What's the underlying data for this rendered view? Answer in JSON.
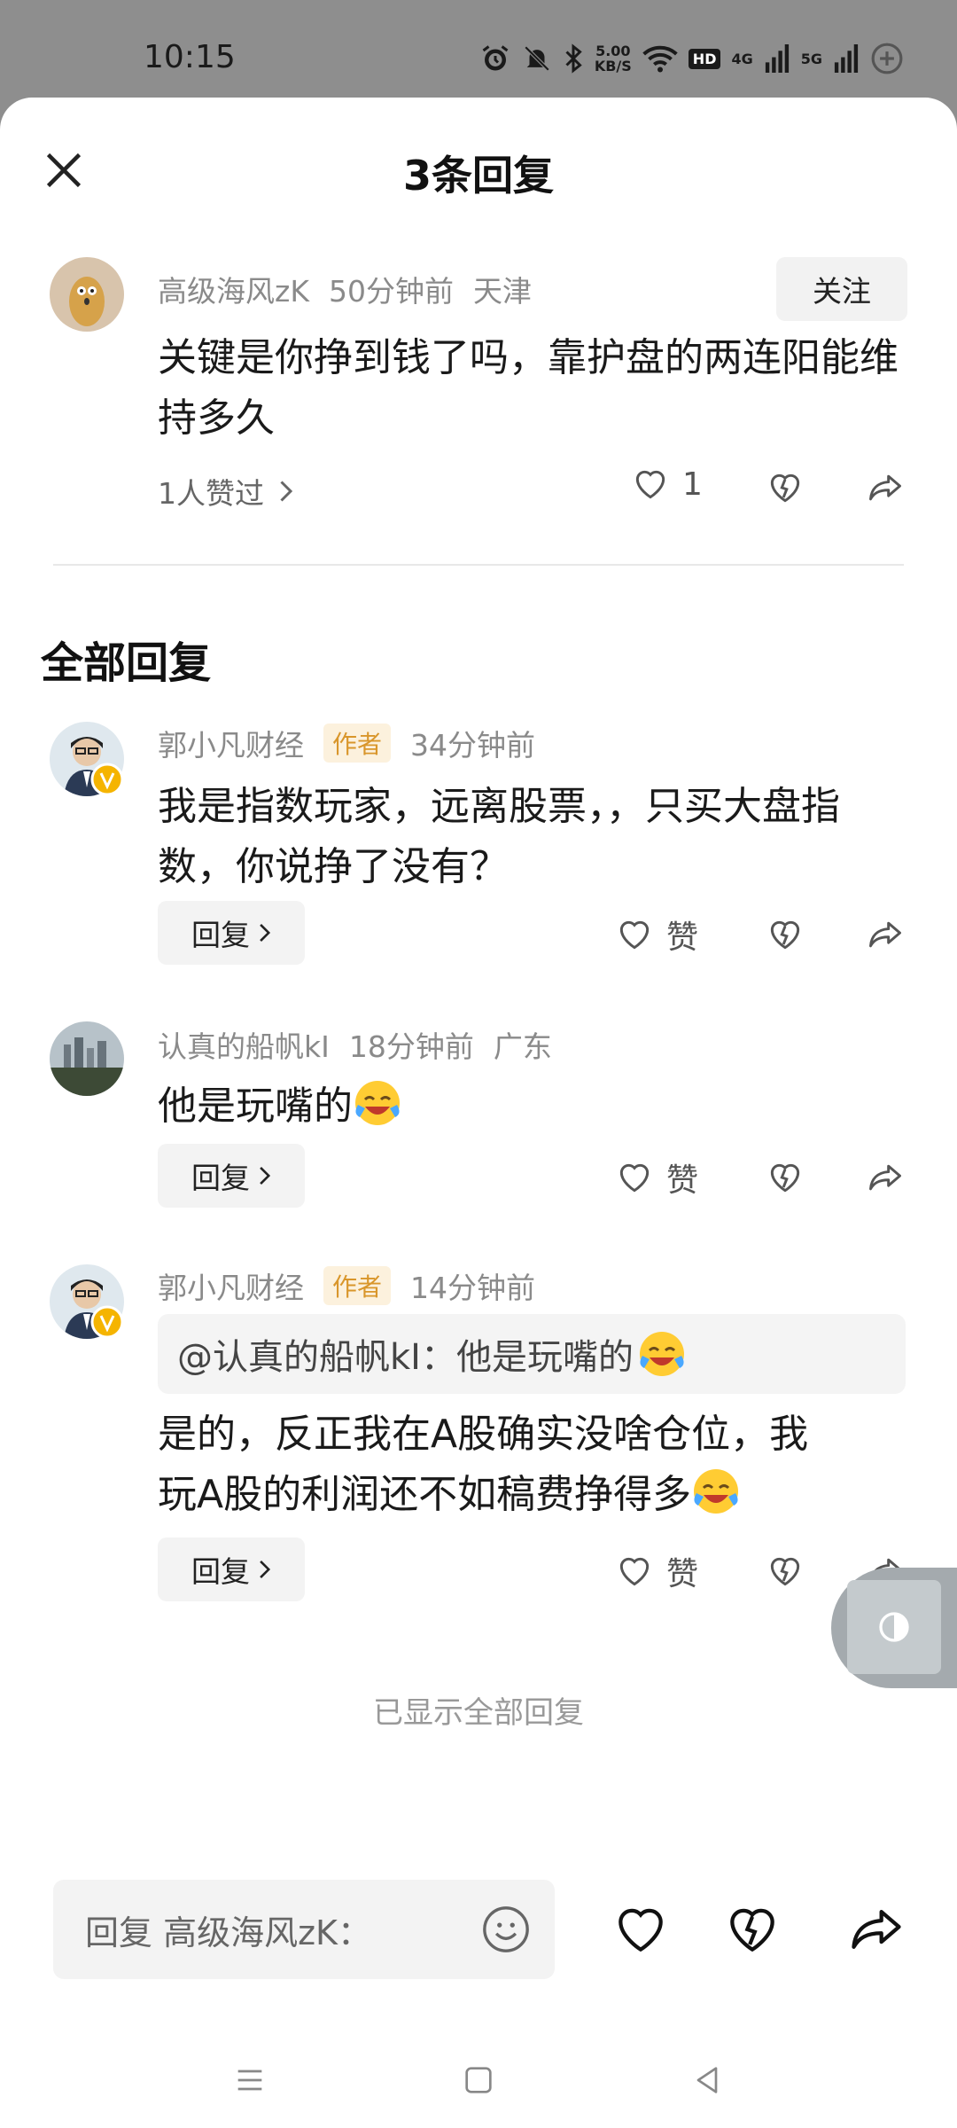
{
  "status_bar": {
    "time": "10:15",
    "net_speed_value": "5.00",
    "net_speed_unit": "KB/S",
    "hd_label": "HD",
    "net1": "4G",
    "net2": "5G"
  },
  "header": {
    "title": "3条回复"
  },
  "original_comment": {
    "user": "高级海风zK",
    "time": "50分钟前",
    "location": "天津",
    "follow_label": "关注",
    "text": "关键是你挣到钱了吗，靠护盘的两连阳能维持多久",
    "likes_link": "1人赞过",
    "like_count": "1"
  },
  "section_title": "全部回复",
  "replies": [
    {
      "user": "郭小凡财经",
      "badge": "作者",
      "time": "34分钟前",
      "text": "我是指数玩家，远离股票，，只买大盘指数，你说挣了没有？",
      "reply_label": "回复",
      "like_label": "赞"
    },
    {
      "user": "认真的船帆kI",
      "time": "18分钟前",
      "location": "广东",
      "text": "他是玩嘴的",
      "reply_label": "回复",
      "like_label": "赞"
    },
    {
      "user": "郭小凡财经",
      "badge": "作者",
      "time": "14分钟前",
      "quote": "@认真的船帆kI：他是玩嘴的",
      "text_line1": "是的，反正我在A股确实没啥仓位，我",
      "text_line2": "玩A股的利润还不如稿费挣得多",
      "reply_label": "回复",
      "like_label": "赞"
    }
  ],
  "end_text": "已显示全部回复",
  "input": {
    "placeholder": "回复 高级海风zK："
  },
  "colors": {
    "accent_badge": "#d9962b",
    "badge_bg": "#fcf1dd",
    "status_bg": "#8e8e8e"
  }
}
